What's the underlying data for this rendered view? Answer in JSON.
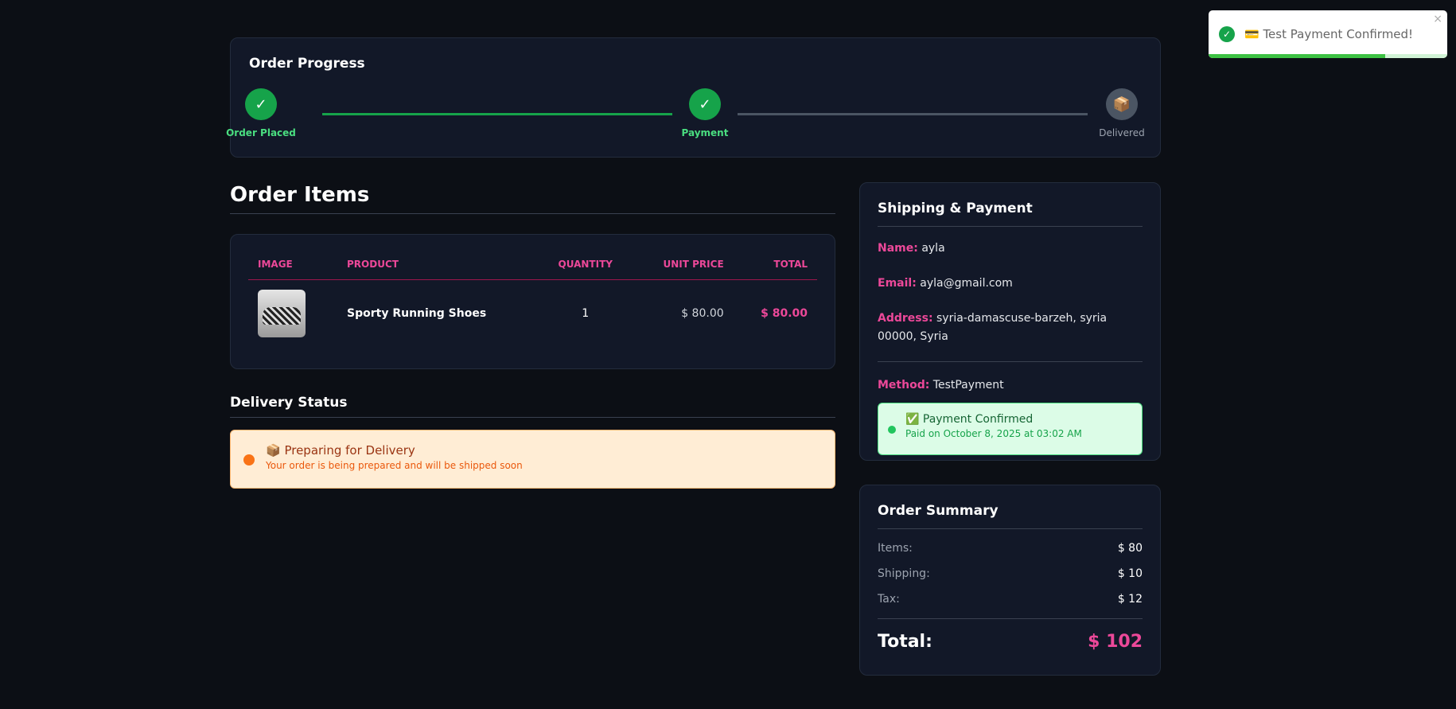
{
  "toast": {
    "icon": "check-circle-icon",
    "message": "💳 Test Payment Confirmed!",
    "close": "×",
    "progress": 0.74
  },
  "progress": {
    "title": "Order Progress",
    "steps": [
      {
        "label": "Order Placed",
        "icon": "✓",
        "status": "done"
      },
      {
        "label": "Payment",
        "icon": "✓",
        "status": "done"
      },
      {
        "label": "Delivered",
        "icon": "📦",
        "status": "pending"
      }
    ],
    "colors": {
      "done": "#16a34a",
      "pending": "#4b5563"
    }
  },
  "items": {
    "title": "Order Items",
    "headers": [
      "IMAGE",
      "PRODUCT",
      "QUANTITY",
      "UNIT PRICE",
      "TOTAL"
    ],
    "rows": [
      {
        "product": "Sporty Running Shoes",
        "quantity": "1",
        "unit_price": "$ 80.00",
        "total": "$ 80.00"
      }
    ]
  },
  "delivery": {
    "title": "Delivery Status",
    "status": "📦 Preparing for Delivery",
    "detail": "Your order is being prepared and will be shipped soon"
  },
  "shipping": {
    "title": "Shipping & Payment",
    "name_label": "Name:",
    "name": "ayla",
    "email_label": "Email:",
    "email": "ayla@gmail.com",
    "address_label": "Address:",
    "address": "syria-damascuse-barzeh, syria 00000, Syria",
    "method_label": "Method:",
    "method": "TestPayment",
    "payment_status": "✅ Payment Confirmed",
    "paid_on": "Paid on October 8, 2025 at 03:02 AM"
  },
  "summary": {
    "title": "Order Summary",
    "items_label": "Items:",
    "items": "$ 80",
    "shipping_label": "Shipping:",
    "shipping": "$ 10",
    "tax_label": "Tax:",
    "tax": "$ 12",
    "total_label": "Total:",
    "total": "$ 102"
  },
  "accent": "#ec4899"
}
